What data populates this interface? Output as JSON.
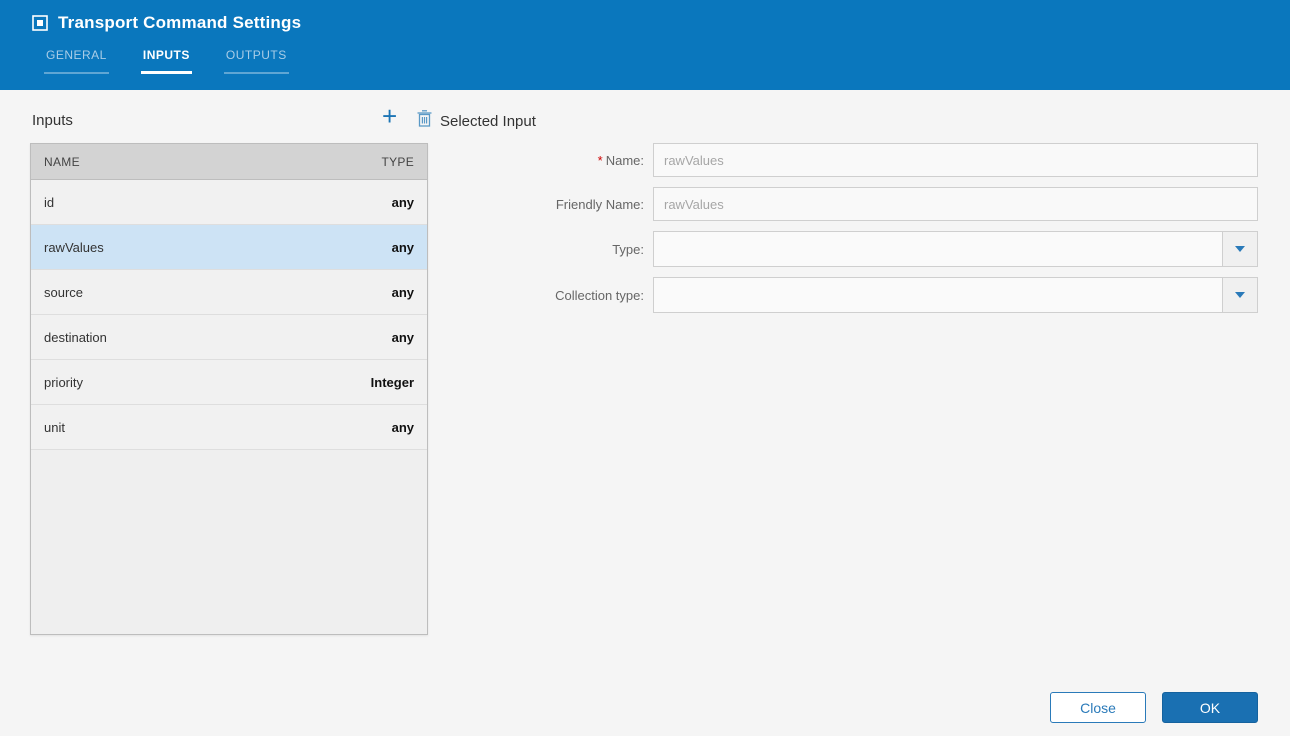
{
  "header": {
    "title": "Transport Command Settings",
    "tabs": [
      {
        "label": "GENERAL",
        "active": false
      },
      {
        "label": "INPUTS",
        "active": true
      },
      {
        "label": "OUTPUTS",
        "active": false
      }
    ]
  },
  "inputs_panel": {
    "title": "Inputs",
    "columns": {
      "name": "NAME",
      "type": "TYPE"
    },
    "rows": [
      {
        "name": "id",
        "type": "any",
        "selected": false
      },
      {
        "name": "rawValues",
        "type": "any",
        "selected": true
      },
      {
        "name": "source",
        "type": "any",
        "selected": false
      },
      {
        "name": "destination",
        "type": "any",
        "selected": false
      },
      {
        "name": "priority",
        "type": "Integer",
        "selected": false
      },
      {
        "name": "unit",
        "type": "any",
        "selected": false
      }
    ]
  },
  "selected_input": {
    "title": "Selected Input",
    "required_marker": "*",
    "fields": {
      "name": {
        "label": "Name:",
        "value": "rawValues"
      },
      "friendly_name": {
        "label": "Friendly Name:",
        "value": "rawValues"
      },
      "type": {
        "label": "Type:",
        "value": ""
      },
      "collection_type": {
        "label": "Collection type:",
        "value": ""
      }
    }
  },
  "footer": {
    "close_label": "Close",
    "ok_label": "OK"
  },
  "colors": {
    "header_bg": "#0a77bd",
    "accent_blue": "#1c75b5",
    "selected_row_bg": "#cde3f5",
    "ok_button_bg": "#1a70b2"
  }
}
